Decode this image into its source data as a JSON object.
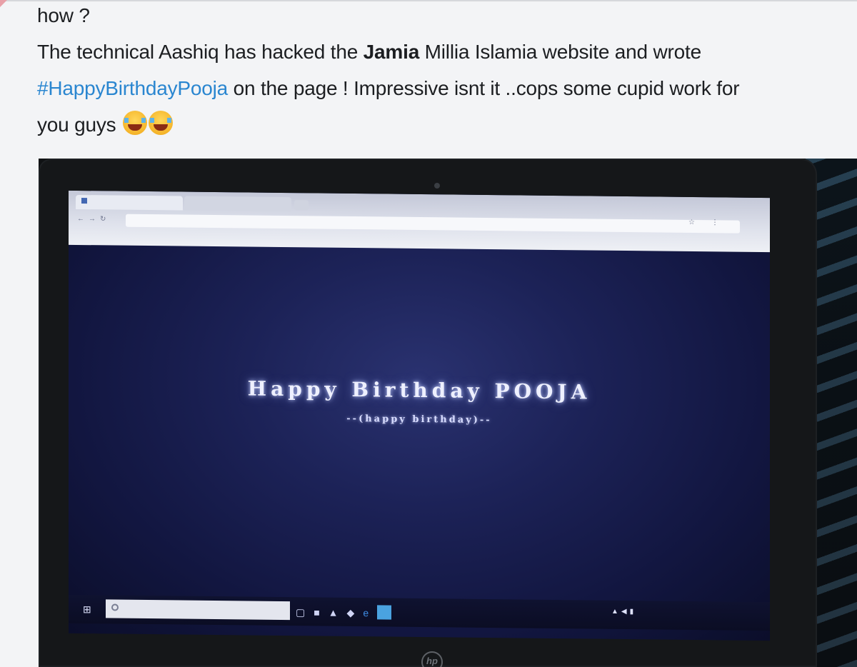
{
  "tweet": {
    "line1": "how ?",
    "line2_a": "The technical Aashiq has hacked the ",
    "line2_bold": "Jamia",
    "line2_b": " Millia Islamia website and wrote",
    "hashtag": "#HappyBirthdayPooja",
    "line3_a": " on the page ! Impressive isnt it ..cops some cupid work for",
    "line4": "you guys",
    "emoji_name": "face-with-tears-of-joy-icon"
  },
  "screen": {
    "title": "Happy Birthday POOJA",
    "subtitle": "--(happy birthday)--"
  }
}
